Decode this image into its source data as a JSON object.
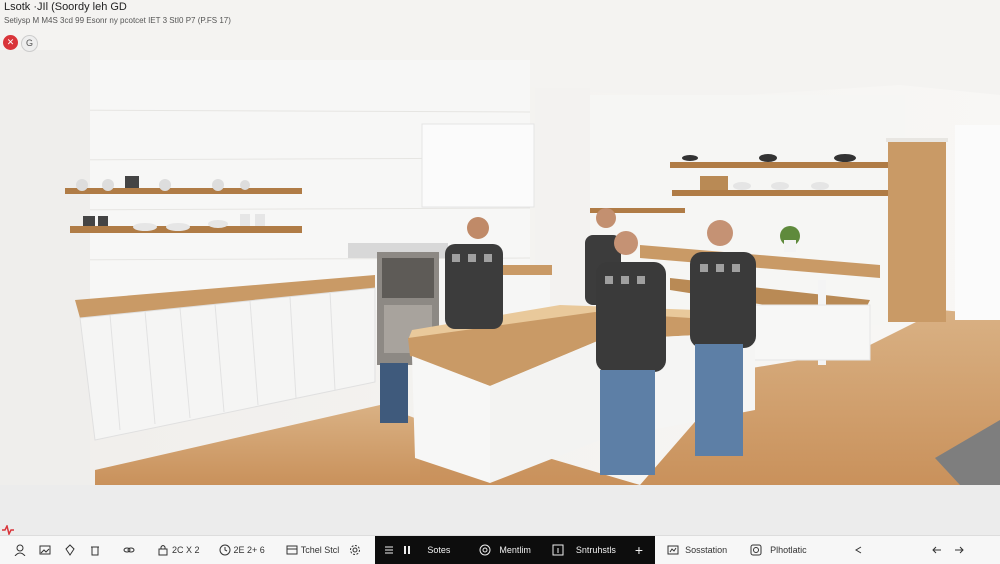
{
  "header": {
    "title": "Lsotk ·JIl (Soordy leh GD",
    "subtitle": "Setiysp M M4S 3cd 99 Esonr ny pcotcet IET 3 StI0 P7 (P.FS 17)"
  },
  "topbar": {
    "close_label": "✕",
    "help_label": "G"
  },
  "toolbar": {
    "items": [
      {
        "id": "t1",
        "label": ""
      },
      {
        "id": "t2",
        "label": ""
      },
      {
        "id": "t3",
        "label": ""
      },
      {
        "id": "t4",
        "label": ""
      },
      {
        "id": "t5",
        "label": ""
      },
      {
        "id": "t6",
        "label": "2C X 2"
      },
      {
        "id": "t7",
        "label": "2E 2+ 6"
      },
      {
        "id": "t8",
        "label": "Tchel Stcl"
      },
      {
        "id": "t9",
        "label": ""
      }
    ],
    "dark": [
      {
        "id": "d1",
        "label": "Sotes"
      },
      {
        "id": "d2",
        "label": "Mentlim"
      },
      {
        "id": "d3",
        "label": "Sntruhstls"
      }
    ],
    "add_label": "+",
    "right": [
      {
        "id": "r1",
        "label": "Sosstation"
      },
      {
        "id": "r2",
        "label": "Plhotlatic"
      }
    ]
  }
}
